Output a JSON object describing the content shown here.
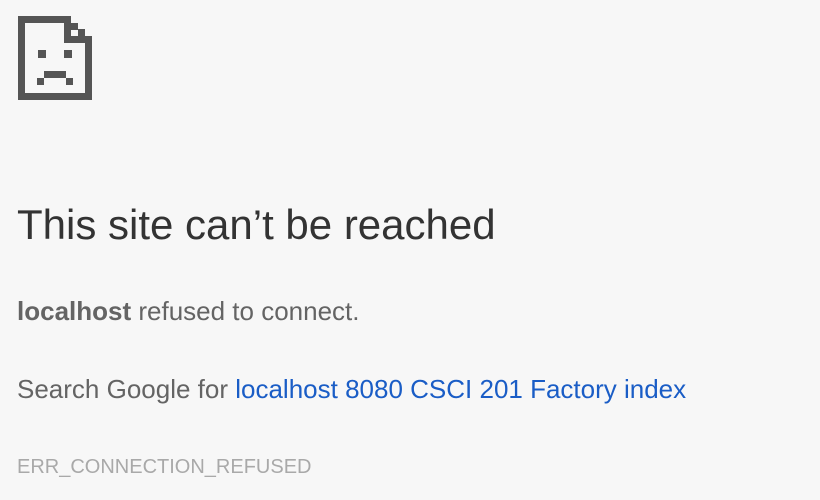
{
  "icon": "sad-page-icon",
  "title": "This site can’t be reached",
  "summary": {
    "host": "localhost",
    "message": " refused to connect."
  },
  "suggestion": {
    "prefix": "Search Google for ",
    "link_text": "localhost 8080 CSCI 201 Factory index"
  },
  "error_code": "ERR_CONNECTION_REFUSED",
  "colors": {
    "background": "#f7f7f7",
    "title": "#333333",
    "body_text": "#646464",
    "link": "#1a5dc6",
    "error_code": "#a9a9a9",
    "icon": "#555555"
  }
}
